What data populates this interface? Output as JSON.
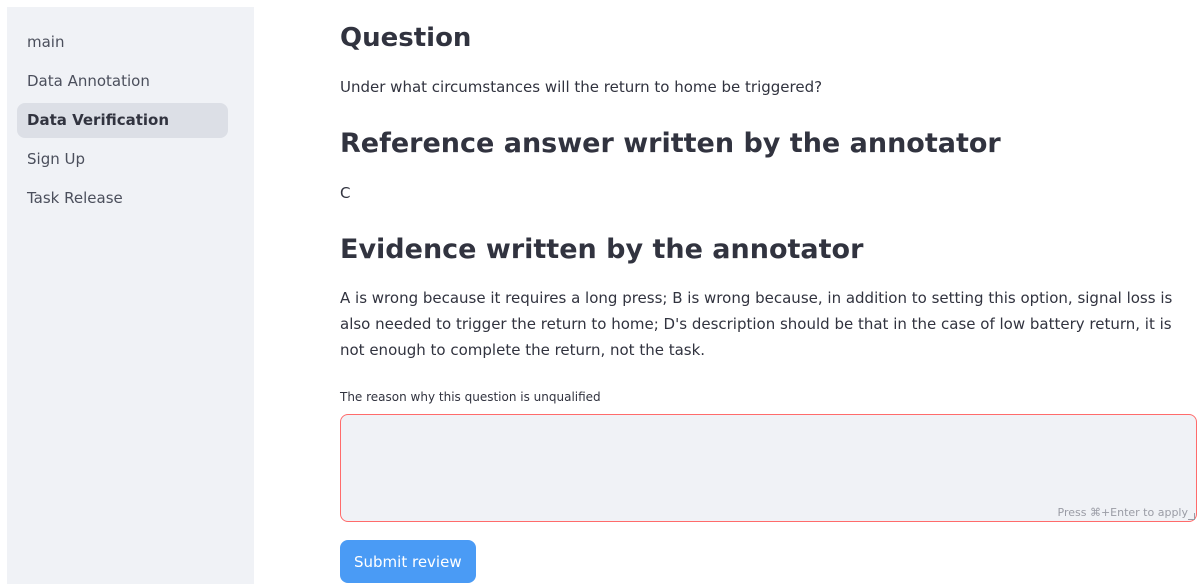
{
  "sidebar": {
    "items": [
      {
        "label": "main",
        "active": false
      },
      {
        "label": "Data Annotation",
        "active": false
      },
      {
        "label": "Data Verification",
        "active": true
      },
      {
        "label": "Sign Up",
        "active": false
      },
      {
        "label": "Task Release",
        "active": false
      }
    ]
  },
  "question": {
    "heading": "Question",
    "text": "Under what circumstances will the return to home be triggered?"
  },
  "reference": {
    "heading": "Reference answer written by the annotator",
    "answer": "C"
  },
  "evidence": {
    "heading": "Evidence written by the annotator",
    "text": "A is wrong because it requires a long press; B is wrong because, in addition to setting this option, signal loss is also needed to trigger the return to home; D's description should be that in the case of low battery return, it is not enough to complete the return, not the task."
  },
  "reason_field": {
    "label": "The reason why this question is unqualified",
    "value": "",
    "hint": "Press ⌘+Enter to apply"
  },
  "submit": {
    "label": "Submit review"
  },
  "colors": {
    "sidebar_bg": "#f0f2f6",
    "active_item_bg": "#dcdfe6",
    "textarea_border": "#ff6b6b",
    "button_bg": "#4a9bf5"
  }
}
